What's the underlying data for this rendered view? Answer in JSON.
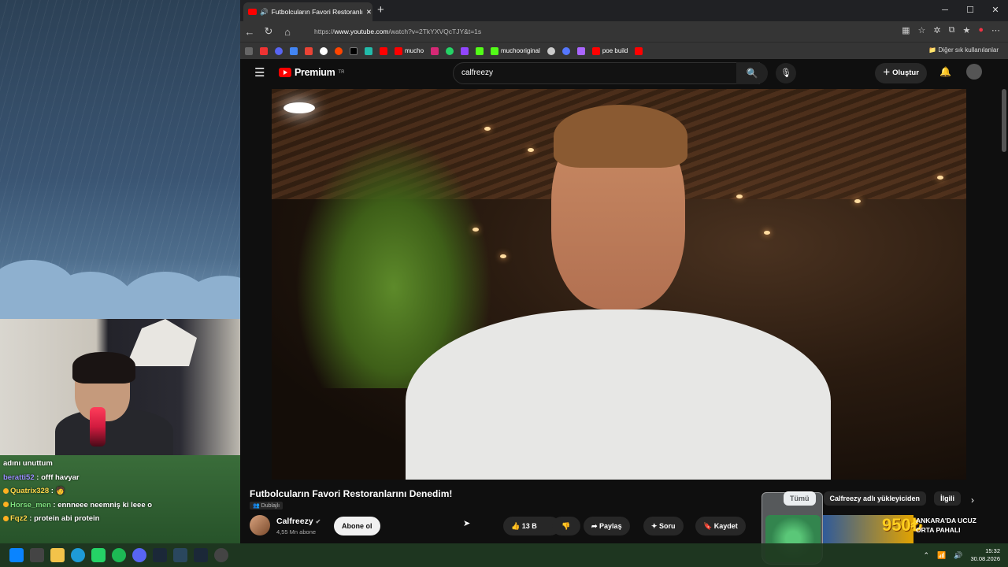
{
  "browser": {
    "tab_title": "Futbolcuların Favori Restoranlı",
    "url_prefix": "https://",
    "url_domain": "www.youtube.com",
    "url_path": "/watch?v=2TkYXVQcTJY&t=1s",
    "bookmarks": [
      "mucho",
      "muchooriginal",
      "poe build"
    ],
    "other_bookmarks": "Diğer sık kullanılanlar"
  },
  "youtube": {
    "logo": "Premium",
    "region": "TR",
    "search_value": "calfreezy",
    "create_label": "Oluştur"
  },
  "video": {
    "title": "Futbolcuların Favori Restoranlarını Denedim!",
    "dub_label": "Dublajlı",
    "channel": "Calfreezy",
    "subscribers": "4,55 Mn abone",
    "subscribe_label": "Abone ol",
    "likes": "13 B",
    "share_label": "Paylaş",
    "ask_label": "Soru",
    "save_label": "Kaydet"
  },
  "chips": [
    "Tümü",
    "Calfreezy adlı yükleyiciden",
    "İlgili"
  ],
  "related": {
    "price": "950₺",
    "title": "ANKARA'DA UCUZ ORTA PAHALI"
  },
  "chat": [
    {
      "user": "",
      "text": "adını unuttum",
      "color": "#ffffff"
    },
    {
      "user": "beratti52",
      "text": "offf havyar",
      "color": "#9b8cff"
    },
    {
      "user": "Quatrix328",
      "text": "",
      "color": "#ffd84a"
    },
    {
      "user": "Horse_men",
      "text": "ennneee neemniş ki leee o",
      "color": "#7ee07e"
    },
    {
      "user": "Fqz2",
      "text": "protein abi protein",
      "color": "#ffd84a"
    }
  ],
  "taskbar": {
    "time": "15:32",
    "date": "30.08.2026"
  },
  "colors": {
    "youtube_red": "#ff0000",
    "background": "#0f0f0f"
  }
}
